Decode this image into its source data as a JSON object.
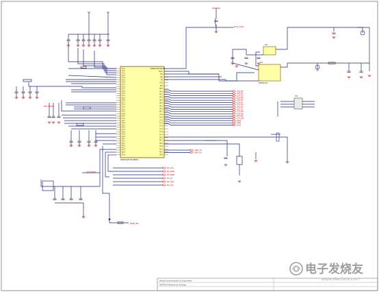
{
  "colors": {
    "wire": "#1a237e",
    "part": "#6b1a1a",
    "net": "#d50000",
    "ic_fill": "#ffffa8",
    "ic_border": "#7a4a00",
    "power": "#c62828",
    "frame": "#777777"
  },
  "ic_main": {
    "part_number": "MSP430F5438",
    "footer": "MSP430F5438IPZ",
    "left_pins": [
      "P1.0",
      "P1.1",
      "P1.2",
      "P1.3",
      "P1.4",
      "P1.5",
      "P1.6",
      "P1.7",
      "P2.0",
      "P2.1",
      "P2.2",
      "P2.3",
      "P2.4",
      "P2.5",
      "P2.6",
      "P2.7",
      "P3.0",
      "P3.1",
      "P3.2",
      "P3.3",
      "P3.4",
      "P3.5",
      "P3.6",
      "P3.7",
      "P4.0",
      "P4.1",
      "P4.2",
      "P4.3",
      "P4.4",
      "P4.5",
      "P4.6",
      "P4.7",
      "P5.0",
      "P5.1",
      "P5.2",
      "P5.3",
      "P5.4",
      "P5.5",
      "P5.6"
    ],
    "right_pins": [
      "DVCC",
      "TCK",
      "TMS",
      "TDI",
      "TDO",
      "RST",
      "TEST",
      "P6.0",
      "P6.1",
      "P6.2",
      "P6.3",
      "P6.4",
      "P6.5",
      "P6.6",
      "P6.7",
      "P7.0",
      "P7.1",
      "P7.2",
      "P7.3",
      "P7.4",
      "P7.5",
      "P7.6",
      "P7.7",
      "P8.0",
      "P8.1",
      "P8.2",
      "P8.3",
      "P8.4",
      "P8.5",
      "P8.6"
    ]
  },
  "ic_small": {
    "u2": {
      "ref": "U2"
    },
    "u3": {
      "ref": "U3",
      "label": "TPS62110"
    },
    "u4": {
      "ref": "U4"
    }
  },
  "nets": {
    "top_right": "3V3_VDD",
    "right_bus": [
      "LCD_D0",
      "LCD_D1",
      "LCD_D2",
      "LCD_D3",
      "LCD_D4",
      "LCD_D5",
      "LCD_D6",
      "LCD_D7",
      "LCD_CS",
      "LCD_WR",
      "LCD_RD",
      "LCD_RS",
      "LCD_RST",
      "LED1",
      "LED2",
      "LED3"
    ],
    "mid_out": [
      "UART_TX",
      "UART_RX"
    ],
    "bottom_out": [
      "SPI_CLK",
      "SPI_MOSI",
      "SPI_MISO",
      "SPI_CS",
      "I2C_SDA",
      "I2C_SCL"
    ],
    "left_in": [
      "BAT_SENSE",
      "VIN_SENSE"
    ],
    "bottom_left": "PWR_EN"
  },
  "title_block": {
    "line1": "Texas Instruments Incorporated",
    "line2": "MSP430 Reference Design"
  },
  "watermark": {
    "text_cn": "电子发烧友",
    "url": "www.elecfans.com"
  }
}
